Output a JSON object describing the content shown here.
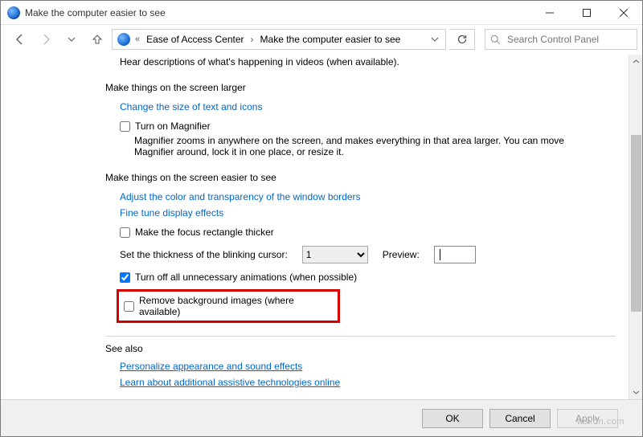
{
  "window": {
    "title": "Make the computer easier to see"
  },
  "breadcrumb": {
    "parent": "Ease of Access Center",
    "current": "Make the computer easier to see"
  },
  "search": {
    "placeholder": "Search Control Panel"
  },
  "body": {
    "hear_desc": "Hear descriptions of what's happening in videos (when available).",
    "larger_head": "Make things on the screen larger",
    "link_textsize": "Change the size of text and icons",
    "cb_magnifier": "Turn on Magnifier",
    "magnifier_desc": "Magnifier zooms in anywhere on the screen, and makes everything in that area larger. You can move Magnifier around, lock it in one place, or resize it.",
    "easier_head": "Make things on the screen easier to see",
    "link_adjust": "Adjust the color and transparency of the window borders",
    "link_effects": "Fine tune display effects",
    "cb_focus": "Make the focus rectangle thicker",
    "cursor_label": "Set the thickness of the blinking cursor:",
    "cursor_value": "1",
    "preview_label": "Preview:",
    "cb_anim": "Turn off all unnecessary animations (when possible)",
    "cb_bg": "Remove background images (where available)",
    "seealso": "See also",
    "link_personalize": "Personalize appearance and sound effects",
    "link_learn": "Learn about additional assistive technologies online"
  },
  "buttons": {
    "ok": "OK",
    "cancel": "Cancel",
    "apply": "Apply"
  },
  "watermark": "wsxdn.com"
}
